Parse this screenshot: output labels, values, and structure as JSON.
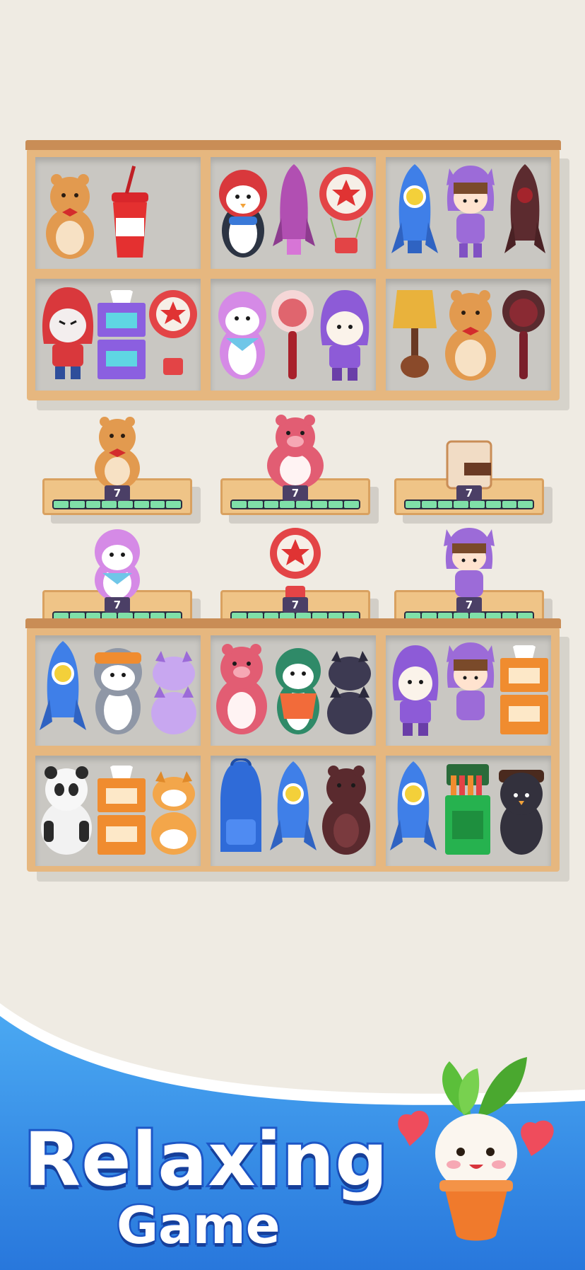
{
  "game": {
    "buffer_trays": [
      {
        "toy": "hamster",
        "count": "7"
      },
      {
        "toy": "pink-bear",
        "count": "7"
      },
      {
        "toy": "wallet",
        "count": "7"
      },
      {
        "toy": "pink-penguin",
        "count": "7"
      },
      {
        "toy": "hot-air-balloon",
        "count": "7"
      },
      {
        "toy": "hooded-girl",
        "count": "7"
      }
    ]
  },
  "banner": {
    "title_line1": "Relaxing",
    "title_line2": "Game"
  },
  "colors": {
    "background": "#efebe3",
    "shelf_wood": "#e6b77f",
    "banner_blue": "#2f8fe6",
    "title_outline": "#1d56c6"
  }
}
